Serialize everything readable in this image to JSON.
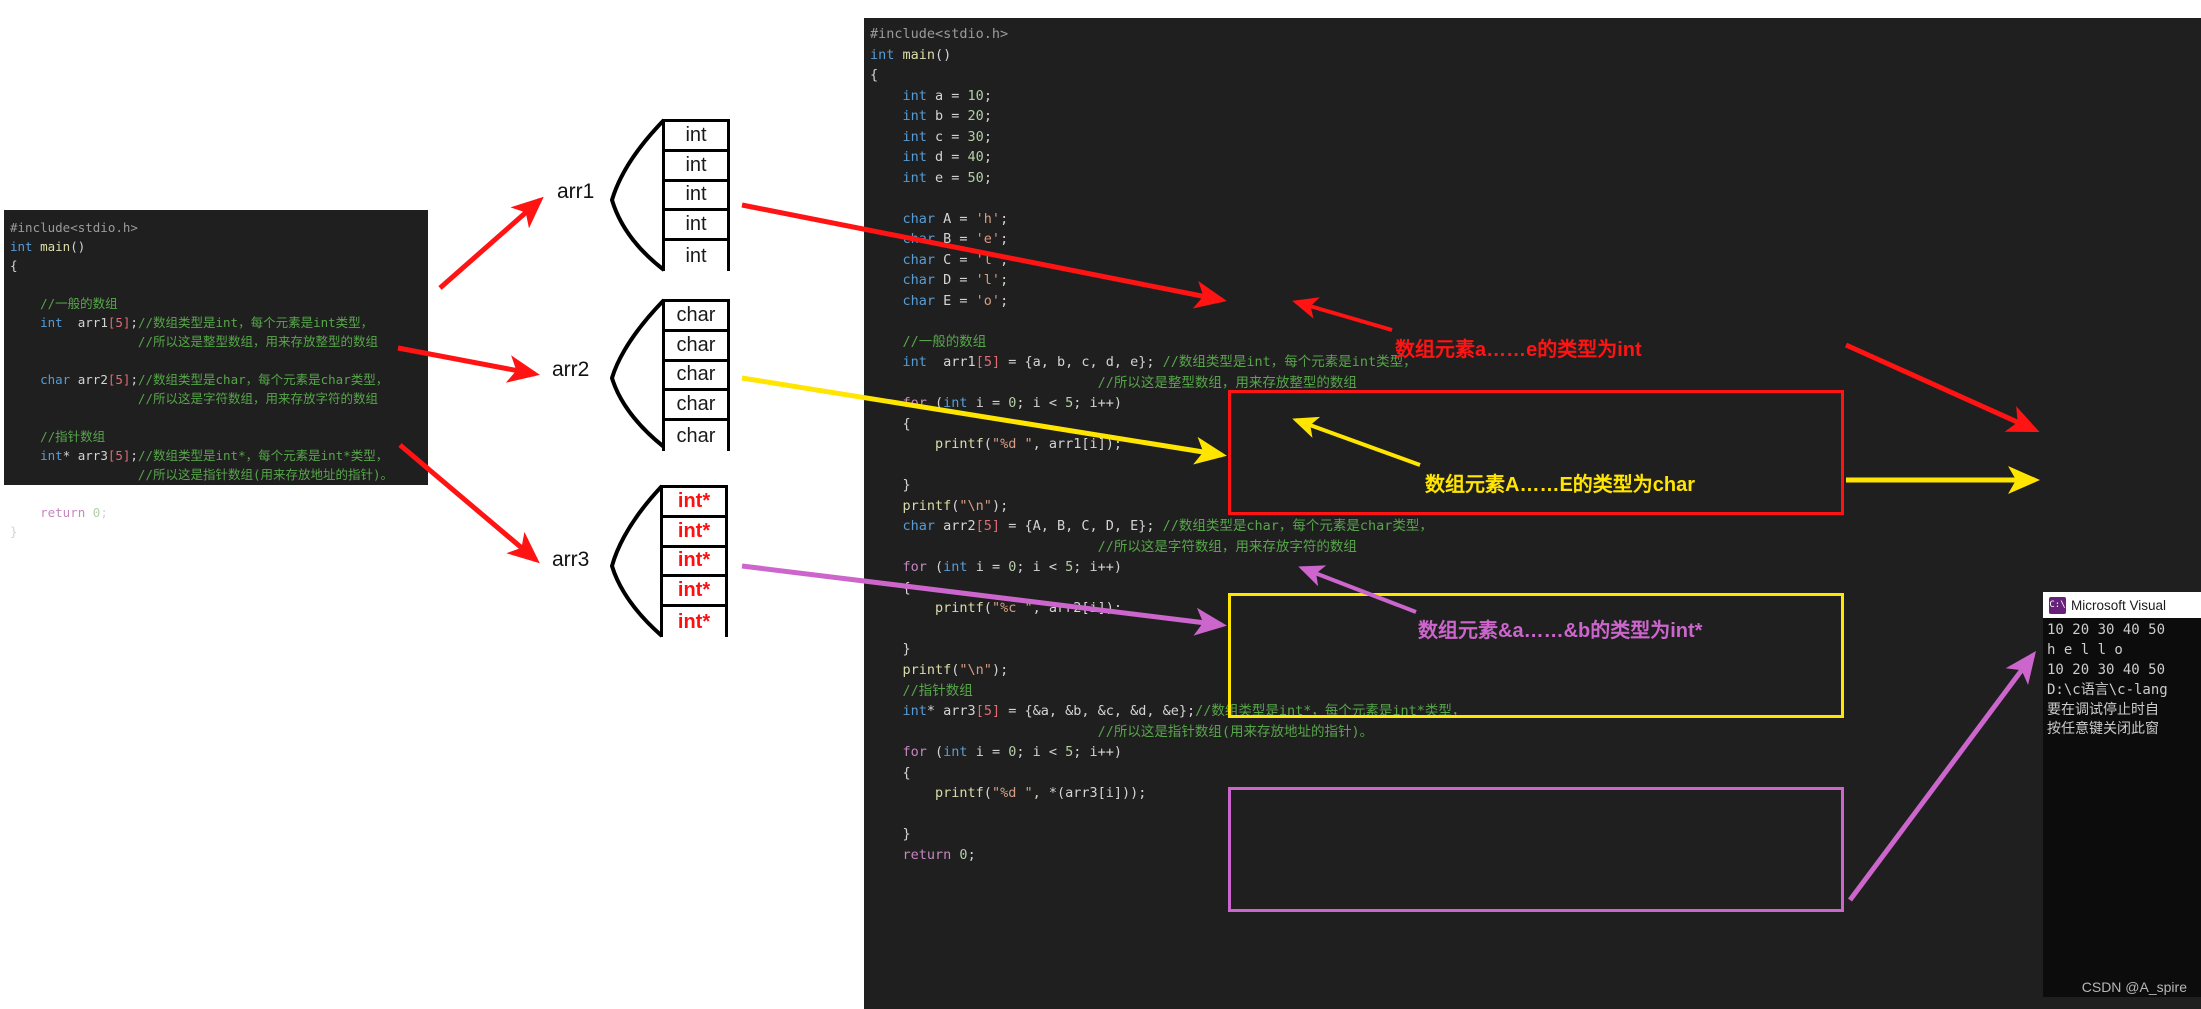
{
  "left_panel": {
    "name": "declaration-code",
    "lines": [
      {
        "t": "pp",
        "s": "#include<stdio.h>"
      },
      {
        "t": "mix",
        "parts": [
          {
            "c": "kw",
            "s": "int"
          },
          {
            "c": "pun",
            "s": " "
          },
          {
            "c": "fn",
            "s": "main"
          },
          {
            "c": "pun",
            "s": "()"
          }
        ]
      },
      {
        "t": "pun",
        "s": "{"
      },
      {
        "t": "blank",
        "s": ""
      },
      {
        "t": "cm",
        "s": "    //一般的数组"
      },
      {
        "t": "mix",
        "parts": [
          {
            "c": "kw",
            "s": "    int"
          },
          {
            "c": "pun",
            "s": "  arr1"
          },
          {
            "c": "brk",
            "s": "[5]"
          },
          {
            "c": "pun",
            "s": ";"
          },
          {
            "c": "cm",
            "s": "//数组类型是int，每个元素是int类型，"
          }
        ]
      },
      {
        "t": "cm",
        "s": "                 //所以这是整型数组，用来存放整型的数组"
      },
      {
        "t": "blank",
        "s": ""
      },
      {
        "t": "mix",
        "parts": [
          {
            "c": "kw",
            "s": "    char"
          },
          {
            "c": "pun",
            "s": " arr2"
          },
          {
            "c": "brk",
            "s": "[5]"
          },
          {
            "c": "pun",
            "s": ";"
          },
          {
            "c": "cm",
            "s": "//数组类型是char，每个元素是char类型，"
          }
        ]
      },
      {
        "t": "cm",
        "s": "                 //所以这是字符数组，用来存放字符的数组"
      },
      {
        "t": "blank",
        "s": ""
      },
      {
        "t": "cm",
        "s": "    //指针数组"
      },
      {
        "t": "mix",
        "parts": [
          {
            "c": "kw",
            "s": "    int"
          },
          {
            "c": "pun",
            "s": "* arr3"
          },
          {
            "c": "brk",
            "s": "[5]"
          },
          {
            "c": "pun",
            "s": ";"
          },
          {
            "c": "cm",
            "s": "//数组类型是int*，每个元素是int*类型，"
          }
        ]
      },
      {
        "t": "cm",
        "s": "                 //所以这是指针数组(用来存放地址的指针)。"
      },
      {
        "t": "blank",
        "s": ""
      },
      {
        "t": "mix",
        "parts": [
          {
            "c": "kw2",
            "s": "    return"
          },
          {
            "c": "pun",
            "s": " "
          },
          {
            "c": "num",
            "s": "0"
          },
          {
            "c": "pun",
            "s": ";"
          }
        ]
      },
      {
        "t": "pun",
        "s": "}"
      }
    ]
  },
  "right_panel": {
    "name": "implementation-code",
    "lines": [
      {
        "parts": [
          {
            "c": "pp",
            "s": "#include<stdio.h>"
          }
        ]
      },
      {
        "parts": [
          {
            "c": "kw",
            "s": "int"
          },
          {
            "c": "pun",
            "s": " "
          },
          {
            "c": "fn",
            "s": "main"
          },
          {
            "c": "pun",
            "s": "()"
          }
        ]
      },
      {
        "parts": [
          {
            "c": "pun",
            "s": "{"
          }
        ]
      },
      {
        "parts": [
          {
            "c": "kw",
            "s": "    int"
          },
          {
            "c": "pun",
            "s": " a = "
          },
          {
            "c": "num",
            "s": "10"
          },
          {
            "c": "pun",
            "s": ";"
          }
        ]
      },
      {
        "parts": [
          {
            "c": "kw",
            "s": "    int"
          },
          {
            "c": "pun",
            "s": " b = "
          },
          {
            "c": "num",
            "s": "20"
          },
          {
            "c": "pun",
            "s": ";"
          }
        ]
      },
      {
        "parts": [
          {
            "c": "kw",
            "s": "    int"
          },
          {
            "c": "pun",
            "s": " c = "
          },
          {
            "c": "num",
            "s": "30"
          },
          {
            "c": "pun",
            "s": ";"
          }
        ]
      },
      {
        "parts": [
          {
            "c": "kw",
            "s": "    int"
          },
          {
            "c": "pun",
            "s": " d = "
          },
          {
            "c": "num",
            "s": "40"
          },
          {
            "c": "pun",
            "s": ";"
          }
        ]
      },
      {
        "parts": [
          {
            "c": "kw",
            "s": "    int"
          },
          {
            "c": "pun",
            "s": " e = "
          },
          {
            "c": "num",
            "s": "50"
          },
          {
            "c": "pun",
            "s": ";"
          }
        ]
      },
      {
        "parts": [
          {
            "c": "pun",
            "s": ""
          }
        ]
      },
      {
        "parts": [
          {
            "c": "kw",
            "s": "    char"
          },
          {
            "c": "pun",
            "s": " A = "
          },
          {
            "c": "str",
            "s": "'h'"
          },
          {
            "c": "pun",
            "s": ";"
          }
        ]
      },
      {
        "parts": [
          {
            "c": "kw",
            "s": "    char"
          },
          {
            "c": "pun",
            "s": " B = "
          },
          {
            "c": "str",
            "s": "'e'"
          },
          {
            "c": "pun",
            "s": ";"
          }
        ]
      },
      {
        "parts": [
          {
            "c": "kw",
            "s": "    char"
          },
          {
            "c": "pun",
            "s": " C = "
          },
          {
            "c": "str",
            "s": "'l'"
          },
          {
            "c": "pun",
            "s": ";"
          }
        ]
      },
      {
        "parts": [
          {
            "c": "kw",
            "s": "    char"
          },
          {
            "c": "pun",
            "s": " D = "
          },
          {
            "c": "str",
            "s": "'l'"
          },
          {
            "c": "pun",
            "s": ";"
          }
        ]
      },
      {
        "parts": [
          {
            "c": "kw",
            "s": "    char"
          },
          {
            "c": "pun",
            "s": " E = "
          },
          {
            "c": "str",
            "s": "'o'"
          },
          {
            "c": "pun",
            "s": ";"
          }
        ]
      },
      {
        "parts": [
          {
            "c": "pun",
            "s": ""
          }
        ]
      },
      {
        "parts": [
          {
            "c": "cm",
            "s": "    //一般的数组"
          }
        ]
      },
      {
        "parts": [
          {
            "c": "kw",
            "s": "    int"
          },
          {
            "c": "pun",
            "s": "  arr1"
          },
          {
            "c": "brk",
            "s": "[5]"
          },
          {
            "c": "pun",
            "s": " = {a, b, c, d, e}; "
          },
          {
            "c": "cm",
            "s": "//数组类型是int，每个元素是int类型，"
          }
        ]
      },
      {
        "parts": [
          {
            "c": "cm",
            "s": "                            //所以这是整型数组，用来存放整型的数组"
          }
        ]
      },
      {
        "parts": [
          {
            "c": "kw2",
            "s": "    for"
          },
          {
            "c": "pun",
            "s": " ("
          },
          {
            "c": "kw",
            "s": "int"
          },
          {
            "c": "pun",
            "s": " i = "
          },
          {
            "c": "num",
            "s": "0"
          },
          {
            "c": "pun",
            "s": "; i < "
          },
          {
            "c": "num",
            "s": "5"
          },
          {
            "c": "pun",
            "s": "; i++)"
          }
        ]
      },
      {
        "parts": [
          {
            "c": "pun",
            "s": "    {"
          }
        ]
      },
      {
        "parts": [
          {
            "c": "fn",
            "s": "        printf"
          },
          {
            "c": "pun",
            "s": "("
          },
          {
            "c": "str",
            "s": "\"%d \""
          },
          {
            "c": "pun",
            "s": ", arr1[i]);"
          }
        ]
      },
      {
        "parts": [
          {
            "c": "pun",
            "s": ""
          }
        ]
      },
      {
        "parts": [
          {
            "c": "pun",
            "s": "    }"
          }
        ]
      },
      {
        "parts": [
          {
            "c": "fn",
            "s": "    printf"
          },
          {
            "c": "pun",
            "s": "("
          },
          {
            "c": "str",
            "s": "\"\\n\""
          },
          {
            "c": "pun",
            "s": ");"
          }
        ]
      },
      {
        "parts": [
          {
            "c": "kw",
            "s": "    char"
          },
          {
            "c": "pun",
            "s": " arr2"
          },
          {
            "c": "brk",
            "s": "[5]"
          },
          {
            "c": "pun",
            "s": " = {A, B, C, D, E}; "
          },
          {
            "c": "cm",
            "s": "//数组类型是char，每个元素是char类型，"
          }
        ]
      },
      {
        "parts": [
          {
            "c": "cm",
            "s": "                            //所以这是字符数组，用来存放字符的数组"
          }
        ]
      },
      {
        "parts": [
          {
            "c": "kw2",
            "s": "    for"
          },
          {
            "c": "pun",
            "s": " ("
          },
          {
            "c": "kw",
            "s": "int"
          },
          {
            "c": "pun",
            "s": " i = "
          },
          {
            "c": "num",
            "s": "0"
          },
          {
            "c": "pun",
            "s": "; i < "
          },
          {
            "c": "num",
            "s": "5"
          },
          {
            "c": "pun",
            "s": "; i++)"
          }
        ]
      },
      {
        "parts": [
          {
            "c": "pun",
            "s": "    {"
          }
        ]
      },
      {
        "parts": [
          {
            "c": "fn",
            "s": "        printf"
          },
          {
            "c": "pun",
            "s": "("
          },
          {
            "c": "str",
            "s": "\"%c \""
          },
          {
            "c": "pun",
            "s": ", arr2[i]);"
          }
        ]
      },
      {
        "parts": [
          {
            "c": "pun",
            "s": ""
          }
        ]
      },
      {
        "parts": [
          {
            "c": "pun",
            "s": "    }"
          }
        ]
      },
      {
        "parts": [
          {
            "c": "fn",
            "s": "    printf"
          },
          {
            "c": "pun",
            "s": "("
          },
          {
            "c": "str",
            "s": "\"\\n\""
          },
          {
            "c": "pun",
            "s": ");"
          }
        ]
      },
      {
        "parts": [
          {
            "c": "cm",
            "s": "    //指针数组"
          }
        ]
      },
      {
        "parts": [
          {
            "c": "kw",
            "s": "    int"
          },
          {
            "c": "pun",
            "s": "* arr3"
          },
          {
            "c": "brk",
            "s": "[5]"
          },
          {
            "c": "pun",
            "s": " = {&a, &b, &c, &d, &e};"
          },
          {
            "c": "cm",
            "s": "//数组类型是int*，每个元素是int*类型，"
          }
        ]
      },
      {
        "parts": [
          {
            "c": "cm",
            "s": "                            //所以这是指针数组(用来存放地址的指针)。"
          }
        ]
      },
      {
        "parts": [
          {
            "c": "kw2",
            "s": "    for"
          },
          {
            "c": "pun",
            "s": " ("
          },
          {
            "c": "kw",
            "s": "int"
          },
          {
            "c": "pun",
            "s": " i = "
          },
          {
            "c": "num",
            "s": "0"
          },
          {
            "c": "pun",
            "s": "; i < "
          },
          {
            "c": "num",
            "s": "5"
          },
          {
            "c": "pun",
            "s": "; i++)"
          }
        ]
      },
      {
        "parts": [
          {
            "c": "pun",
            "s": "    {"
          }
        ]
      },
      {
        "parts": [
          {
            "c": "fn",
            "s": "        printf"
          },
          {
            "c": "pun",
            "s": "("
          },
          {
            "c": "str",
            "s": "\"%d \""
          },
          {
            "c": "pun",
            "s": ", *(arr3[i]));"
          }
        ]
      },
      {
        "parts": [
          {
            "c": "pun",
            "s": ""
          }
        ]
      },
      {
        "parts": [
          {
            "c": "pun",
            "s": "    }"
          }
        ]
      },
      {
        "parts": [
          {
            "c": "kw2",
            "s": "    return"
          },
          {
            "c": "pun",
            "s": " "
          },
          {
            "c": "num",
            "s": "0"
          },
          {
            "c": "pun",
            "s": ";"
          }
        ]
      }
    ]
  },
  "arrays": [
    {
      "label": "arr1",
      "cell_text": "int",
      "count": 5,
      "text_color": "#1a1a1a"
    },
    {
      "label": "arr2",
      "cell_text": "char",
      "count": 5,
      "text_color": "#1a1a1a"
    },
    {
      "label": "arr3",
      "cell_text": "int*",
      "count": 5,
      "text_color": "#ff1010"
    }
  ],
  "annotations": [
    {
      "text": "数组元素a……e的类型为int",
      "color": "#ff1313"
    },
    {
      "text": "数组元素A……E的类型为char",
      "color": "#ffe500"
    },
    {
      "text": "数组元素&a……&b的类型为int*",
      "color": "#cc66cc"
    }
  ],
  "console": {
    "title": "Microsoft Visual",
    "icon": "console-icon",
    "icon_glyph": "C:\\",
    "lines": [
      "10 20 30 40 50",
      "h e l l o",
      "10 20 30 40 50",
      "D:\\c语言\\c-lang",
      "要在调试停止时自",
      "按任意键关闭此窗"
    ]
  },
  "watermark": "CSDN @A_spire",
  "colors": {
    "red": "#ff1313",
    "yellow": "#ffe500",
    "purple": "#cc66cc",
    "editor_bg": "#1f1f1f"
  }
}
